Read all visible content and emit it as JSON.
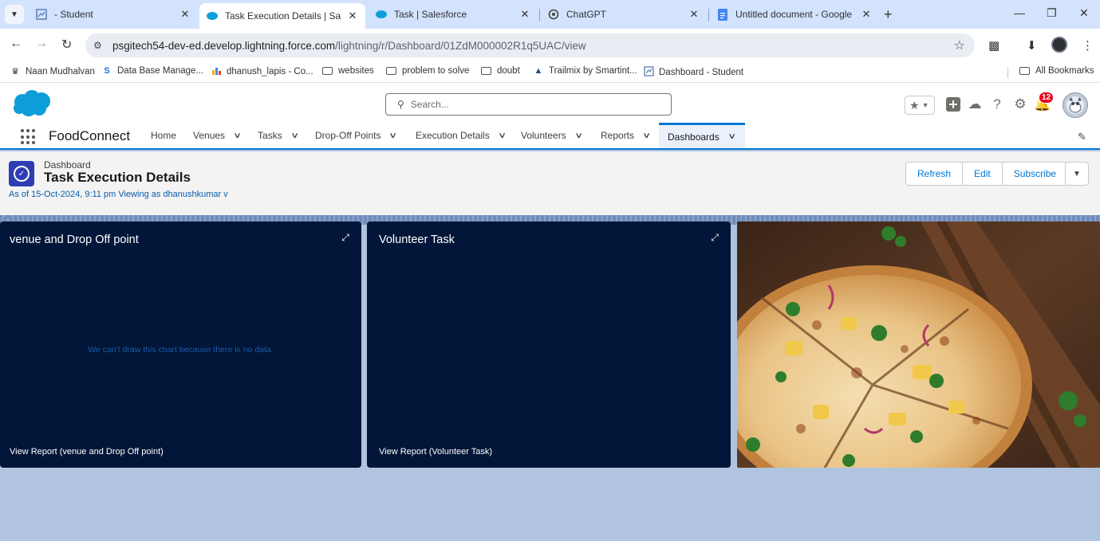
{
  "browser": {
    "tabs": [
      {
        "title": "- Student",
        "icon": "dashboard-icon"
      },
      {
        "title": "Task Execution Details | Salesfor",
        "icon": "salesforce-cloud-icon",
        "active": true
      },
      {
        "title": "Task | Salesforce",
        "icon": "salesforce-cloud-icon"
      },
      {
        "title": "ChatGPT",
        "icon": "chatgpt-icon"
      },
      {
        "title": "Untitled document - Google Do",
        "icon": "google-docs-icon"
      }
    ],
    "url_host": "psgitech54-dev-ed.develop.lightning.force.com",
    "url_path": "/lightning/r/Dashboard/01ZdM000002R1q5UAC/view"
  },
  "bookmarks": [
    {
      "label": "Naan Mudhalvan",
      "icon": "naan-mudhalvan-icon"
    },
    {
      "label": "Data Base Manage...",
      "icon": "s-logo-icon"
    },
    {
      "label": "dhanush_lapis - Co...",
      "icon": "chart-bars-icon"
    },
    {
      "label": "websites",
      "icon": "folder-icon"
    },
    {
      "label": "problem to solve",
      "icon": "folder-icon"
    },
    {
      "label": "doubt",
      "icon": "folder-icon"
    },
    {
      "label": "Trailmix by Smartint...",
      "icon": "trailhead-icon"
    },
    {
      "label": "Dashboard - Student",
      "icon": "dashboard-icon"
    }
  ],
  "all_bookmarks": "All Bookmarks",
  "sf": {
    "search_placeholder": "Search...",
    "notification_count": "12",
    "app_name": "FoodConnect",
    "nav": [
      {
        "label": "Home",
        "dropdown": false
      },
      {
        "label": "Venues",
        "dropdown": true
      },
      {
        "label": "Tasks",
        "dropdown": true
      },
      {
        "label": "Drop-Off Points",
        "dropdown": true
      },
      {
        "label": "Execution Details",
        "dropdown": true
      },
      {
        "label": "Volunteers",
        "dropdown": true
      },
      {
        "label": "Reports",
        "dropdown": true
      },
      {
        "label": "Dashboards",
        "dropdown": true,
        "active": true
      }
    ]
  },
  "dashboard": {
    "type_label": "Dashboard",
    "title": "Task Execution Details",
    "as_of": "As of 15-Oct-2024, 9:11 pm Viewing as dhanushkumar v",
    "buttons": {
      "refresh": "Refresh",
      "edit": "Edit",
      "subscribe": "Subscribe"
    },
    "widgets": [
      {
        "title": "venue and Drop Off point",
        "message": "We can't draw this chart because there is no data.",
        "footer": "View Report (venue and Drop Off point)"
      },
      {
        "title": "Volunteer Task",
        "message": "",
        "footer": "View Report (Volunteer Task)"
      }
    ],
    "image_alt": "Pizza on a wooden board"
  },
  "colors": {
    "accent": "#0176d3",
    "widget_bg": "#011638",
    "canvas_bg": "#b0c4df",
    "badge": "#ea001e"
  }
}
